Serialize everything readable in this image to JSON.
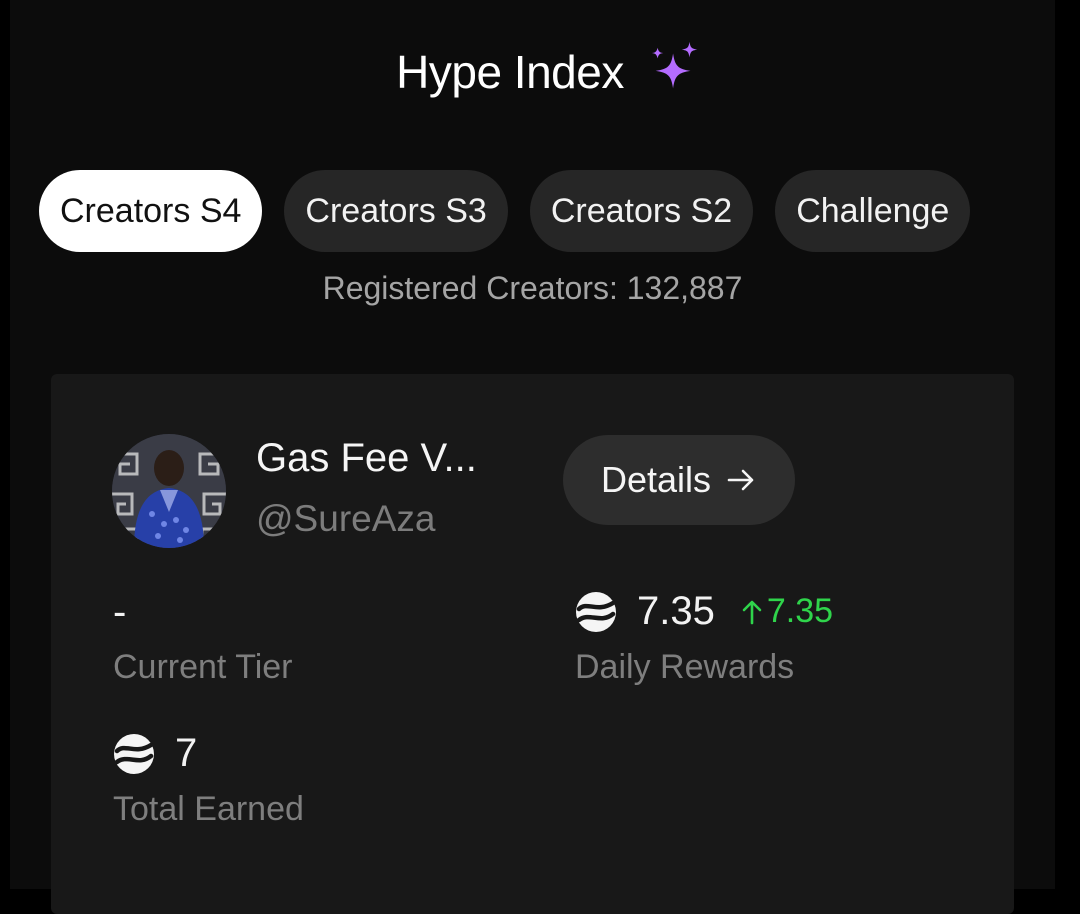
{
  "header": {
    "title": "Hype Index",
    "icon": "sparkles-icon",
    "icon_color": "#b46cff"
  },
  "tabs": [
    {
      "label": "Creators S4",
      "active": true
    },
    {
      "label": "Creators S3",
      "active": false
    },
    {
      "label": "Creators S2",
      "active": false
    },
    {
      "label": "Challenge",
      "active": false
    }
  ],
  "registered": {
    "text": "Registered Creators: 132,887"
  },
  "profile": {
    "name": "Gas Fee V...",
    "handle": "@SureAza",
    "details_label": "Details"
  },
  "stats": {
    "current_tier": {
      "value": "-",
      "label": "Current Tier"
    },
    "daily_rewards": {
      "value": "7.35",
      "change": "7.35",
      "label": "Daily Rewards",
      "change_color": "#2fd44b"
    },
    "total_earned": {
      "value": "7",
      "label": "Total Earned"
    }
  },
  "colors": {
    "background": "#000000",
    "card": "#181818",
    "tab_inactive": "#262626",
    "tab_active": "#ffffff",
    "positive": "#2fd44b"
  }
}
